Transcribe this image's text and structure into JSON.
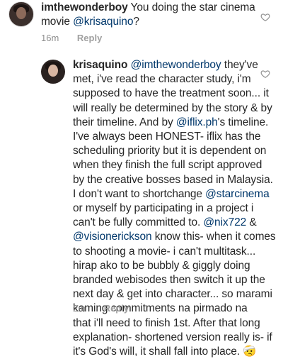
{
  "comments": [
    {
      "username": "imthewonderboy",
      "lines": [
        [
          {
            "t": "imthewonderboy",
            "k": "user"
          },
          {
            "t": " You doing the star cinema",
            "k": "text"
          }
        ],
        [
          {
            "t": "movie ",
            "k": "text"
          },
          {
            "t": "@krisaquino",
            "k": "mention"
          },
          {
            "t": "?",
            "k": "text"
          }
        ]
      ],
      "time": "16m",
      "reply_label": "Reply"
    },
    {
      "username": "krisaquino",
      "lines": [
        [
          {
            "t": "krisaquino",
            "k": "user"
          },
          {
            "t": " ",
            "k": "text"
          },
          {
            "t": "@imthewonderboy",
            "k": "mention"
          },
          {
            "t": " they've",
            "k": "text"
          }
        ],
        [
          {
            "t": "met, i've read the character study, i'm",
            "k": "text"
          }
        ],
        [
          {
            "t": "supposed to have the treatment soon... it",
            "k": "text"
          }
        ],
        [
          {
            "t": "will really be determined by the story & by",
            "k": "text"
          }
        ],
        [
          {
            "t": "their timeline. And by ",
            "k": "text"
          },
          {
            "t": "@iflix.ph",
            "k": "mention"
          },
          {
            "t": "'s timeline.",
            "k": "text"
          }
        ],
        [
          {
            "t": "I've always been HONEST- iflix has the",
            "k": "text"
          }
        ],
        [
          {
            "t": "scheduling priority but it is dependent on",
            "k": "text"
          }
        ],
        [
          {
            "t": "when they finish the full script approved",
            "k": "text"
          }
        ],
        [
          {
            "t": "by the creative bosses based in Malaysia.",
            "k": "text"
          }
        ],
        [
          {
            "t": "I don't want to shortchange ",
            "k": "text"
          },
          {
            "t": "@starcinema",
            "k": "mention"
          }
        ],
        [
          {
            "t": "or myself by participating in a project i",
            "k": "text"
          }
        ],
        [
          {
            "t": "can't be fully committed to. ",
            "k": "text"
          },
          {
            "t": "@nix722",
            "k": "mention"
          },
          {
            "t": " &",
            "k": "text"
          }
        ],
        [
          {
            "t": "@visionerickson",
            "k": "mention"
          },
          {
            "t": " know this- when it comes",
            "k": "text"
          }
        ],
        [
          {
            "t": "to shooting a movie- i can't multitask...",
            "k": "text"
          }
        ],
        [
          {
            "t": "hirap ako to be bubbly & giggly doing",
            "k": "text"
          }
        ],
        [
          {
            "t": "branded webisodes then switch it up the",
            "k": "text"
          }
        ],
        [
          {
            "t": "next day & get into character... so marami",
            "k": "text"
          }
        ],
        [
          {
            "t": "kaming commitments na pirmado na",
            "k": "text"
          }
        ],
        [
          {
            "t": "that i'll need to finish 1st. After that long",
            "k": "text"
          }
        ],
        [
          {
            "t": "explanation- shortened version really is- if",
            "k": "text"
          }
        ],
        [
          {
            "t": "it's God's will, it shall fall into place. ",
            "k": "text"
          },
          {
            "t": "🤕",
            "k": "text"
          }
        ]
      ],
      "time": "2m",
      "reply_label": "Reply"
    }
  ],
  "colors": {
    "text": "#262626",
    "mention": "#00376b",
    "meta": "#8e8e8e"
  },
  "icons": [
    "heart-outline-icon",
    "heart-outline-icon"
  ]
}
